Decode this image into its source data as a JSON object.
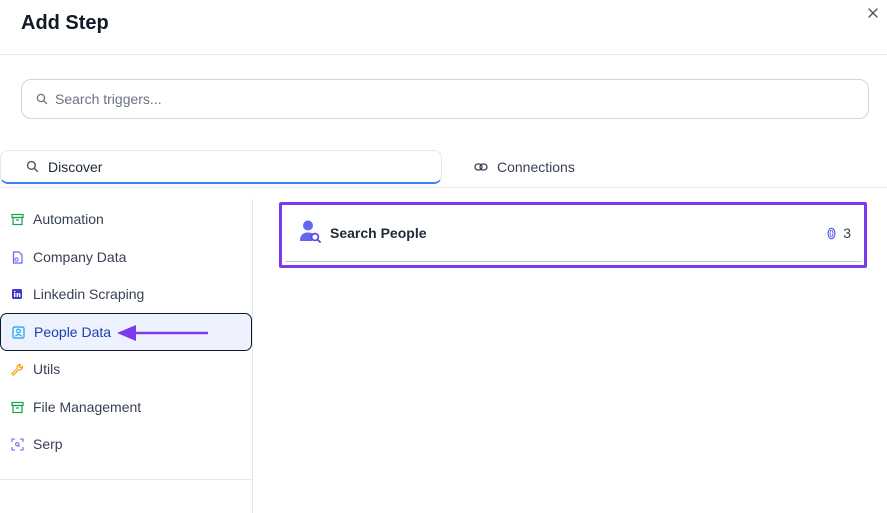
{
  "dialog": {
    "title": "Add Step",
    "close_icon": "close-icon"
  },
  "search": {
    "placeholder": "Search triggers...",
    "value": ""
  },
  "tabs": [
    {
      "label": "Discover",
      "icon": "search-icon",
      "active": true
    },
    {
      "label": "Connections",
      "icon": "link-icon",
      "active": false
    }
  ],
  "categories": [
    {
      "label": "Automation",
      "icon": "archive-icon",
      "color": "#16a34a"
    },
    {
      "label": "Company Data",
      "icon": "file-icon",
      "color": "#6366f1"
    },
    {
      "label": "Linkedin Scraping",
      "icon": "linkedin-icon",
      "color": "#4338ca"
    },
    {
      "label": "People Data",
      "icon": "contact-card-icon",
      "color": "#0ea5e9",
      "active": true
    },
    {
      "label": "Utils",
      "icon": "wrench-icon",
      "color": "#f59e0b"
    },
    {
      "label": "File Management",
      "icon": "archive-icon",
      "color": "#16a34a"
    },
    {
      "label": "Serp",
      "icon": "scan-icon",
      "color": "#6366f1"
    }
  ],
  "results": [
    {
      "name": "Search People",
      "icon": "person-search-icon",
      "credits": "3",
      "credit_icon": "coin-icon"
    }
  ],
  "colors": {
    "accent": "#7c3aed",
    "tab_underline": "#3b82f6",
    "active_bg": "#eef2ff",
    "person_icon": "#6366f1"
  }
}
